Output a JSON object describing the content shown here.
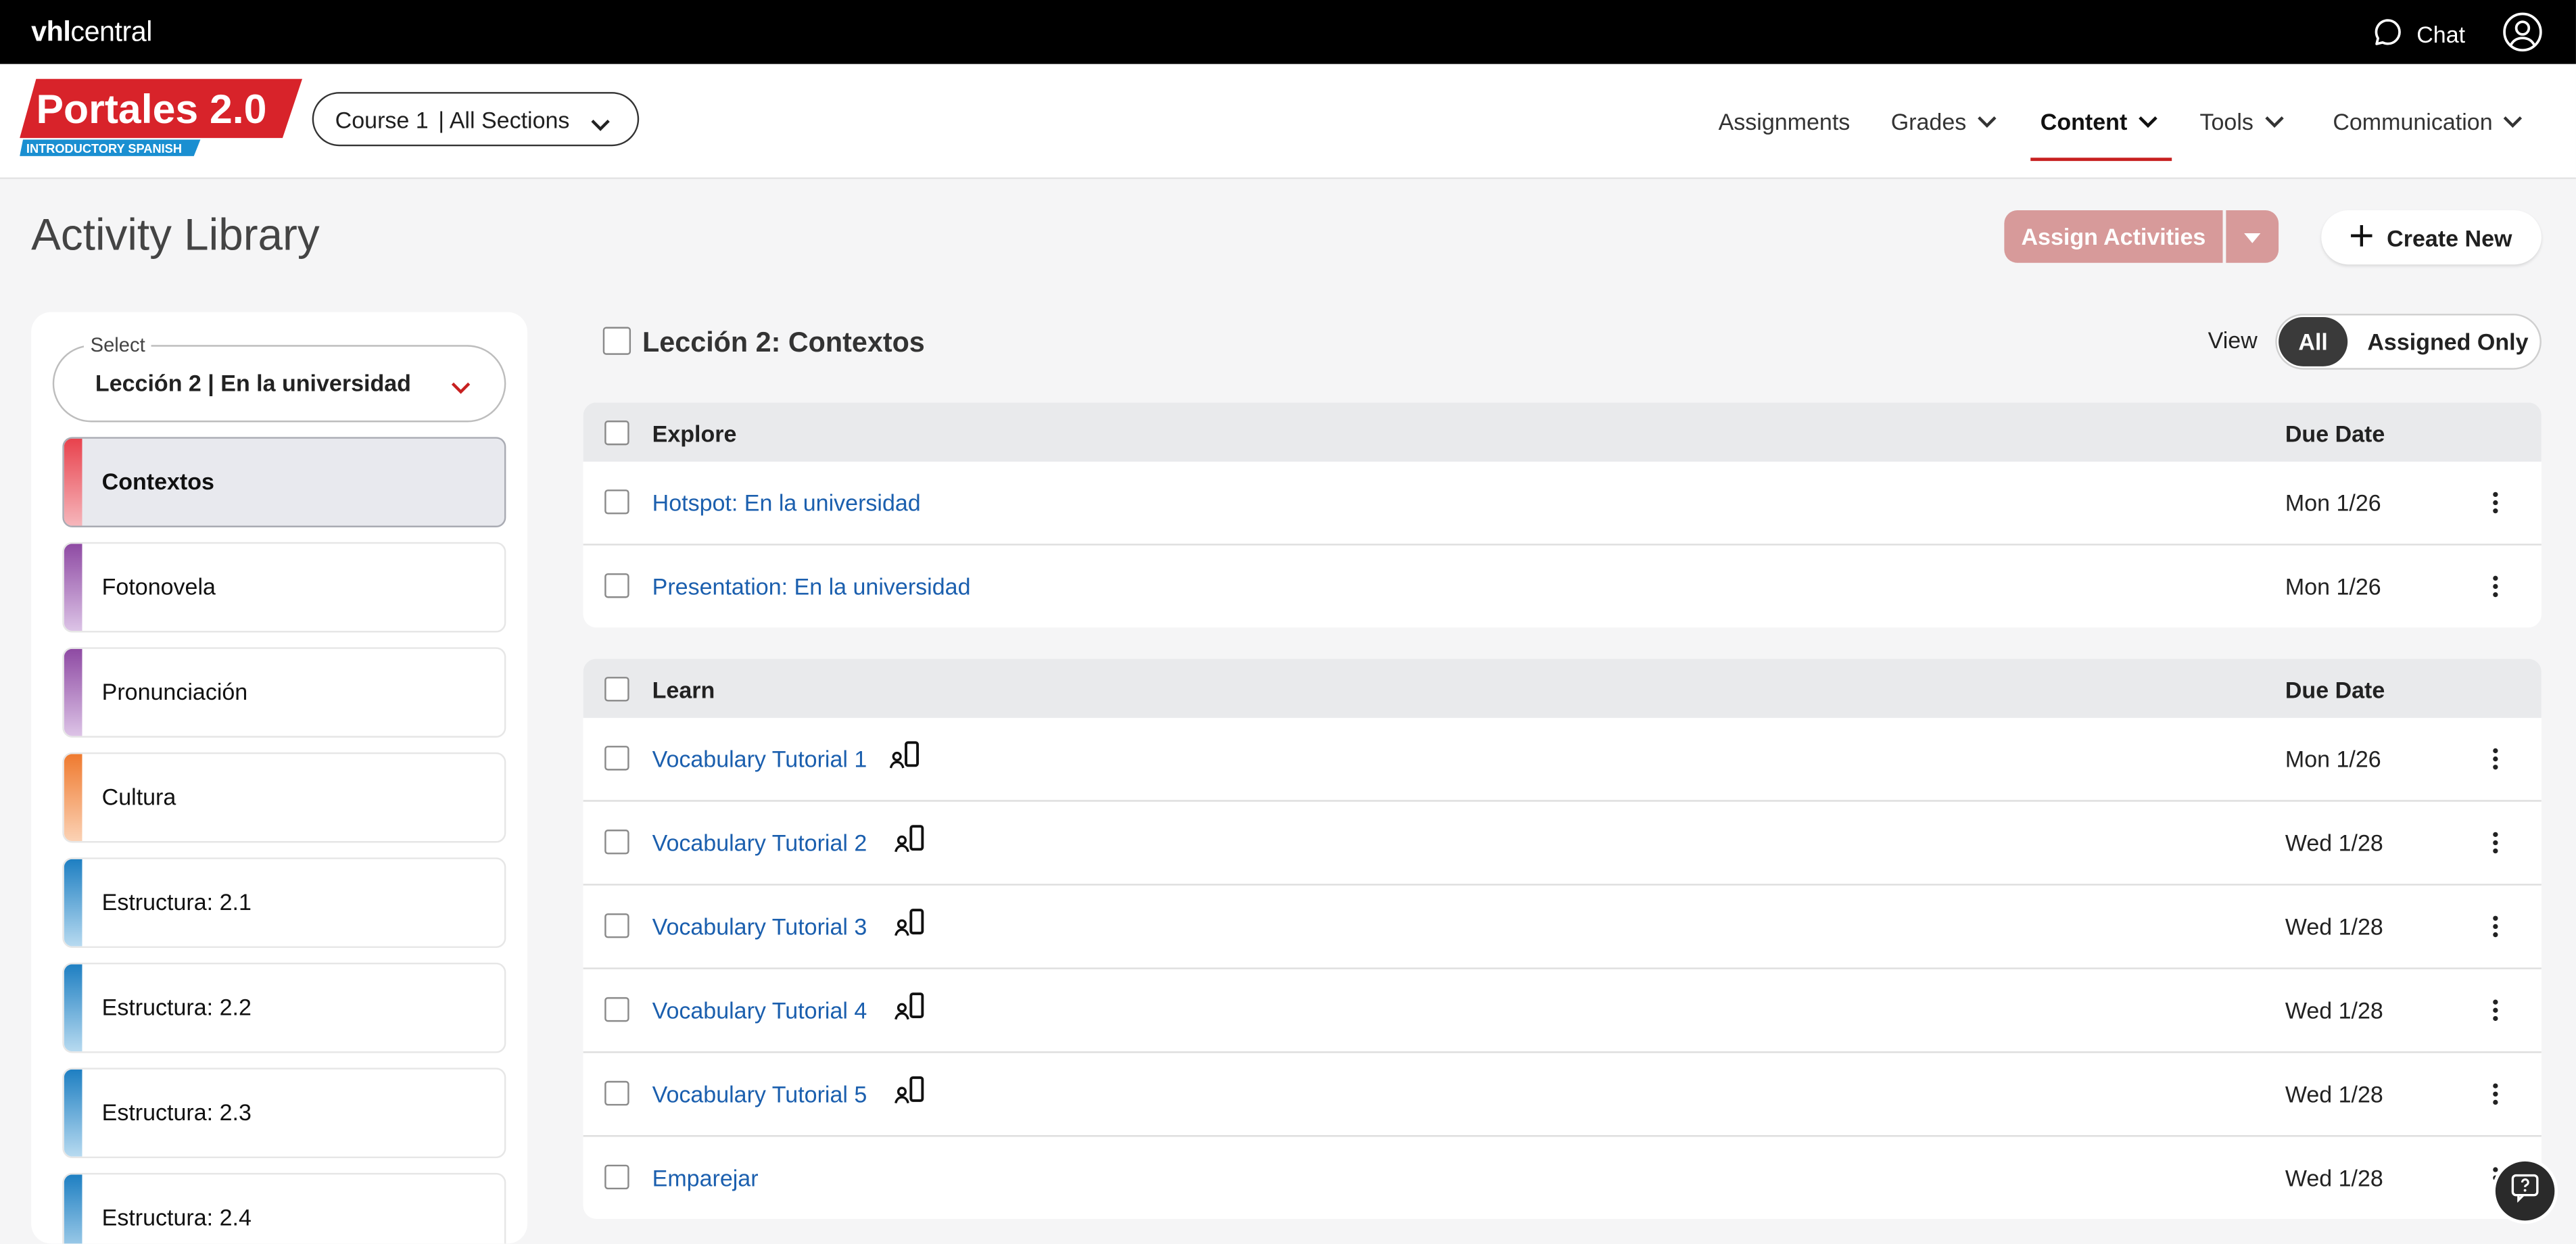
{
  "topbar": {
    "brand_bold": "vhl",
    "brand_rest": "central",
    "chat_label": "Chat"
  },
  "header": {
    "logo_title": "Portales 2.0",
    "logo_subtitle": "INTRODUCTORY SPANISH",
    "course_name": "Course 1",
    "course_section": "| All Sections",
    "nav": [
      {
        "label": "Assignments"
      },
      {
        "label": "Grades"
      },
      {
        "label": "Content"
      },
      {
        "label": "Tools"
      },
      {
        "label": "Communication"
      }
    ]
  },
  "page": {
    "title": "Activity Library",
    "assign_label": "Assign Activities",
    "create_label": "Create New"
  },
  "sidebar": {
    "select_legend": "Select",
    "select_value": "Lección 2 | En la universidad",
    "sections": [
      {
        "label": "Contextos",
        "color_top": "#e8424d",
        "color_bottom": "#f6b6bb",
        "selected": true
      },
      {
        "label": "Fotonovela",
        "color_top": "#8e4aa3",
        "color_bottom": "#dcc3e6"
      },
      {
        "label": "Pronunciación",
        "color_top": "#8e4aa3",
        "color_bottom": "#dcc3e6"
      },
      {
        "label": "Cultura",
        "color_top": "#ef7a2f",
        "color_bottom": "#fbd2b5"
      },
      {
        "label": "Estructura: 2.1",
        "color_top": "#1e7fc2",
        "color_bottom": "#b7daf0"
      },
      {
        "label": "Estructura: 2.2",
        "color_top": "#1e7fc2",
        "color_bottom": "#b7daf0"
      },
      {
        "label": "Estructura: 2.3",
        "color_top": "#1e7fc2",
        "color_bottom": "#b7daf0"
      },
      {
        "label": "Estructura: 2.4",
        "color_top": "#1e7fc2",
        "color_bottom": "#b7daf0"
      }
    ]
  },
  "main": {
    "lesson_title": "Lección 2: Contextos",
    "view_label": "View",
    "view_all": "All",
    "view_assigned": "Assigned Only",
    "groups": [
      {
        "name": "Explore",
        "due_header": "Due Date",
        "rows": [
          {
            "title": "Hotspot: En la universidad",
            "due": "Mon 1/26"
          },
          {
            "title": "Presentation: En la universidad",
            "due": "Mon 1/26"
          }
        ]
      },
      {
        "name": "Learn",
        "due_header": "Due Date",
        "rows": [
          {
            "title": "Vocabulary Tutorial 1",
            "due": "Mon 1/26",
            "icon": "mobile-ready-icon"
          },
          {
            "title": "Vocabulary Tutorial 2",
            "due": "Wed 1/28",
            "icon": "mobile-ready-icon"
          },
          {
            "title": "Vocabulary Tutorial 3",
            "due": "Wed 1/28",
            "icon": "mobile-ready-icon"
          },
          {
            "title": "Vocabulary Tutorial 4",
            "due": "Wed 1/28",
            "icon": "mobile-ready-icon"
          },
          {
            "title": "Vocabulary Tutorial 5",
            "due": "Wed 1/28",
            "icon": "mobile-ready-icon"
          },
          {
            "title": "Emparejar",
            "due": "Wed 1/28"
          }
        ]
      }
    ]
  },
  "colors": {
    "accent_red": "#c72020",
    "link_blue": "#1b5fae",
    "assign_disabled": "#d79a9a"
  }
}
